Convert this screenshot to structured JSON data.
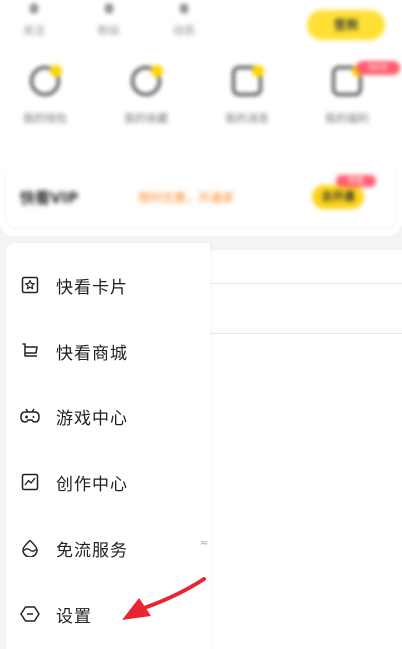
{
  "header": {
    "stats": [
      {
        "value": "0",
        "label": "关注"
      },
      {
        "value": "0",
        "label": "粉丝"
      },
      {
        "value": "0",
        "label": "动态"
      }
    ],
    "signin_label": "签到"
  },
  "quick_actions": {
    "items": [
      {
        "label": "我的钱包",
        "icon": "wallet-icon"
      },
      {
        "label": "我的收藏",
        "icon": "favorites-icon"
      },
      {
        "label": "我的消息",
        "icon": "messages-icon"
      },
      {
        "label": "我的福利",
        "icon": "welfare-icon"
      }
    ],
    "badge": "NEW"
  },
  "vip": {
    "title": "快看VIP",
    "promo": "限时优惠，开通享",
    "button": "去开通",
    "badge": "特惠"
  },
  "menu": {
    "items": [
      {
        "label": "快看卡片",
        "icon": "card-icon"
      },
      {
        "label": "快看商城",
        "icon": "shopping-cart-icon"
      },
      {
        "label": "游戏中心",
        "icon": "gamepad-icon"
      },
      {
        "label": "创作中心",
        "icon": "chart-icon"
      },
      {
        "label": "免流服务",
        "icon": "water-drop-icon"
      },
      {
        "label": "设置",
        "icon": "settings-icon"
      }
    ]
  },
  "scroll_hint": "≈",
  "colors": {
    "accent_yellow": "#ffe033",
    "badge_red": "#ff5c6e",
    "promo_orange": "#ff8a2a",
    "arrow_red": "#e8262f"
  }
}
